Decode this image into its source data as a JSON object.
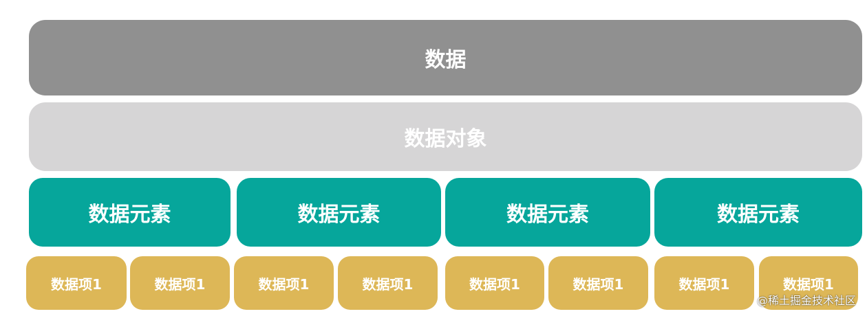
{
  "colors": {
    "level_0": "#909090",
    "level_1": "#d6d5d6",
    "level_2": "#06a69b",
    "level_3": "#ddb757"
  },
  "diagram": {
    "level_0": {
      "label": "数据"
    },
    "level_1": {
      "label": "数据对象"
    },
    "level_2": [
      {
        "label": "数据元素"
      },
      {
        "label": "数据元素"
      },
      {
        "label": "数据元素"
      },
      {
        "label": "数据元素"
      }
    ],
    "level_3": [
      {
        "label": "数据项1"
      },
      {
        "label": "数据项1"
      },
      {
        "label": "数据项1"
      },
      {
        "label": "数据项1"
      },
      {
        "label": "数据项1"
      },
      {
        "label": "数据项1"
      },
      {
        "label": "数据项1"
      },
      {
        "label": "数据项1"
      }
    ]
  },
  "watermark": "@稀土掘金技术社区"
}
